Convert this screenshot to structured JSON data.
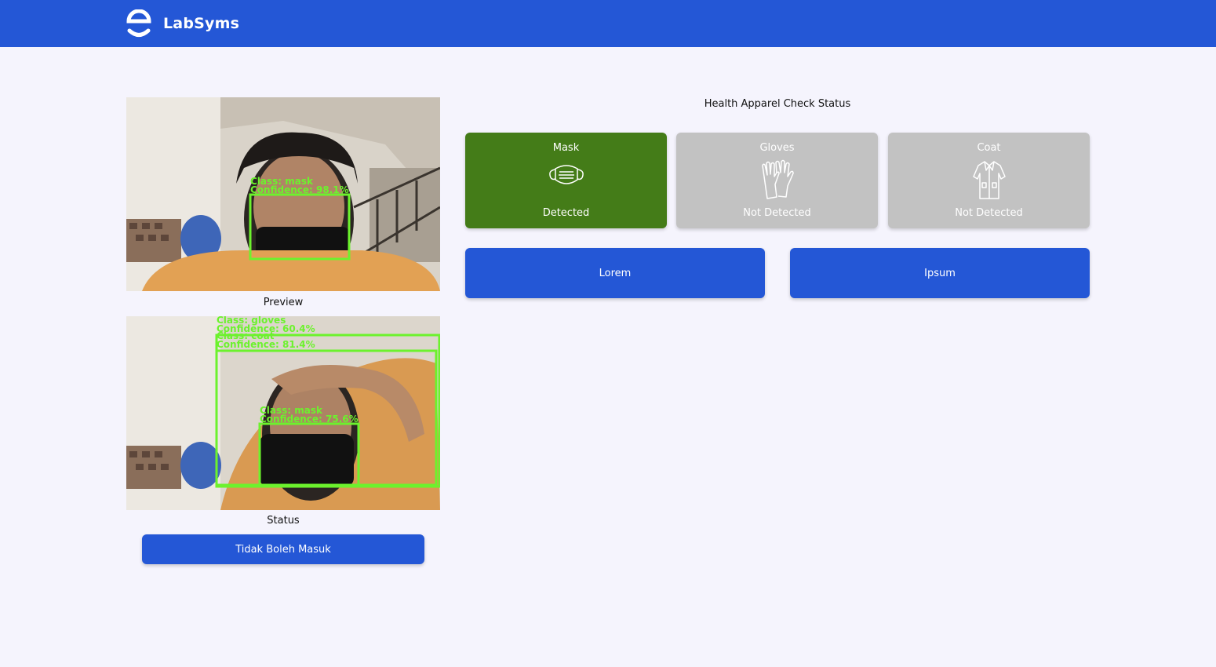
{
  "header": {
    "app_name": "LabSyms",
    "logo_icon": "labsyms-e-logo",
    "background_color": "#2457d6"
  },
  "preview": {
    "caption": "Preview",
    "detections": [
      {
        "class_text": "Class: mask",
        "confidence_text": "Confidence: 98.1%"
      }
    ]
  },
  "status_feed": {
    "caption": "Status",
    "detections": [
      {
        "class_text": "Class: gloves",
        "confidence_text": "Confidence: 60.4%"
      },
      {
        "class_text": "Class: coat",
        "confidence_text": "Confidence: 81.4%"
      },
      {
        "class_text": "Class: mask",
        "confidence_text": "Confidence: 75.6%"
      }
    ]
  },
  "verdict_button": {
    "label": "Tidak Boleh Masuk"
  },
  "apparel": {
    "title": "Health Apparel Check Status",
    "detected_color": "#447c18",
    "not_detected_color": "#c2c2c2",
    "items": [
      {
        "name": "Mask",
        "icon": "mask-icon",
        "status": "Detected"
      },
      {
        "name": "Gloves",
        "icon": "gloves-icon",
        "status": "Not Detected"
      },
      {
        "name": "Coat",
        "icon": "coat-icon",
        "status": "Not Detected"
      }
    ]
  },
  "actions": [
    {
      "label": "Lorem"
    },
    {
      "label": "Ipsum"
    }
  ],
  "detection_box_color": "#6cf22d"
}
